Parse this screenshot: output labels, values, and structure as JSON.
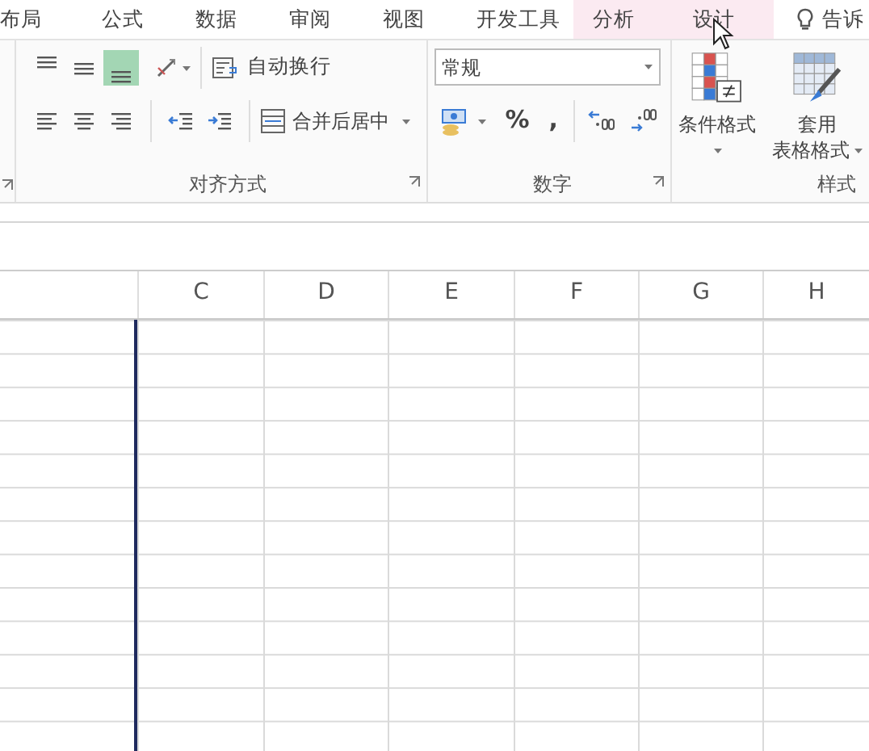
{
  "tabs": [
    {
      "label": "布局",
      "selected": false,
      "contextual": false
    },
    {
      "label": "公式",
      "selected": false,
      "contextual": false
    },
    {
      "label": "数据",
      "selected": false,
      "contextual": false
    },
    {
      "label": "审阅",
      "selected": false,
      "contextual": false
    },
    {
      "label": "视图",
      "selected": false,
      "contextual": false
    },
    {
      "label": "开发工具",
      "selected": false,
      "contextual": false
    },
    {
      "label": "分析",
      "selected": false,
      "contextual": true
    },
    {
      "label": "设计",
      "selected": false,
      "contextual": true
    }
  ],
  "tell_me": "告诉",
  "alignment": {
    "vertical_align": [
      {
        "selected": false
      },
      {
        "selected": false
      },
      {
        "selected": true
      }
    ],
    "wrap_text": "自动换行",
    "merge_center": "合并后居中",
    "label": "对齐方式"
  },
  "number": {
    "format": "常规",
    "percent": "%",
    "comma": ",",
    "label": "数字"
  },
  "styles": {
    "conditional_format": "条件格式",
    "table_format": [
      "套用",
      "表格格式"
    ],
    "label": "样式"
  },
  "columns": [
    "C",
    "D",
    "E",
    "F",
    "G",
    "H"
  ]
}
